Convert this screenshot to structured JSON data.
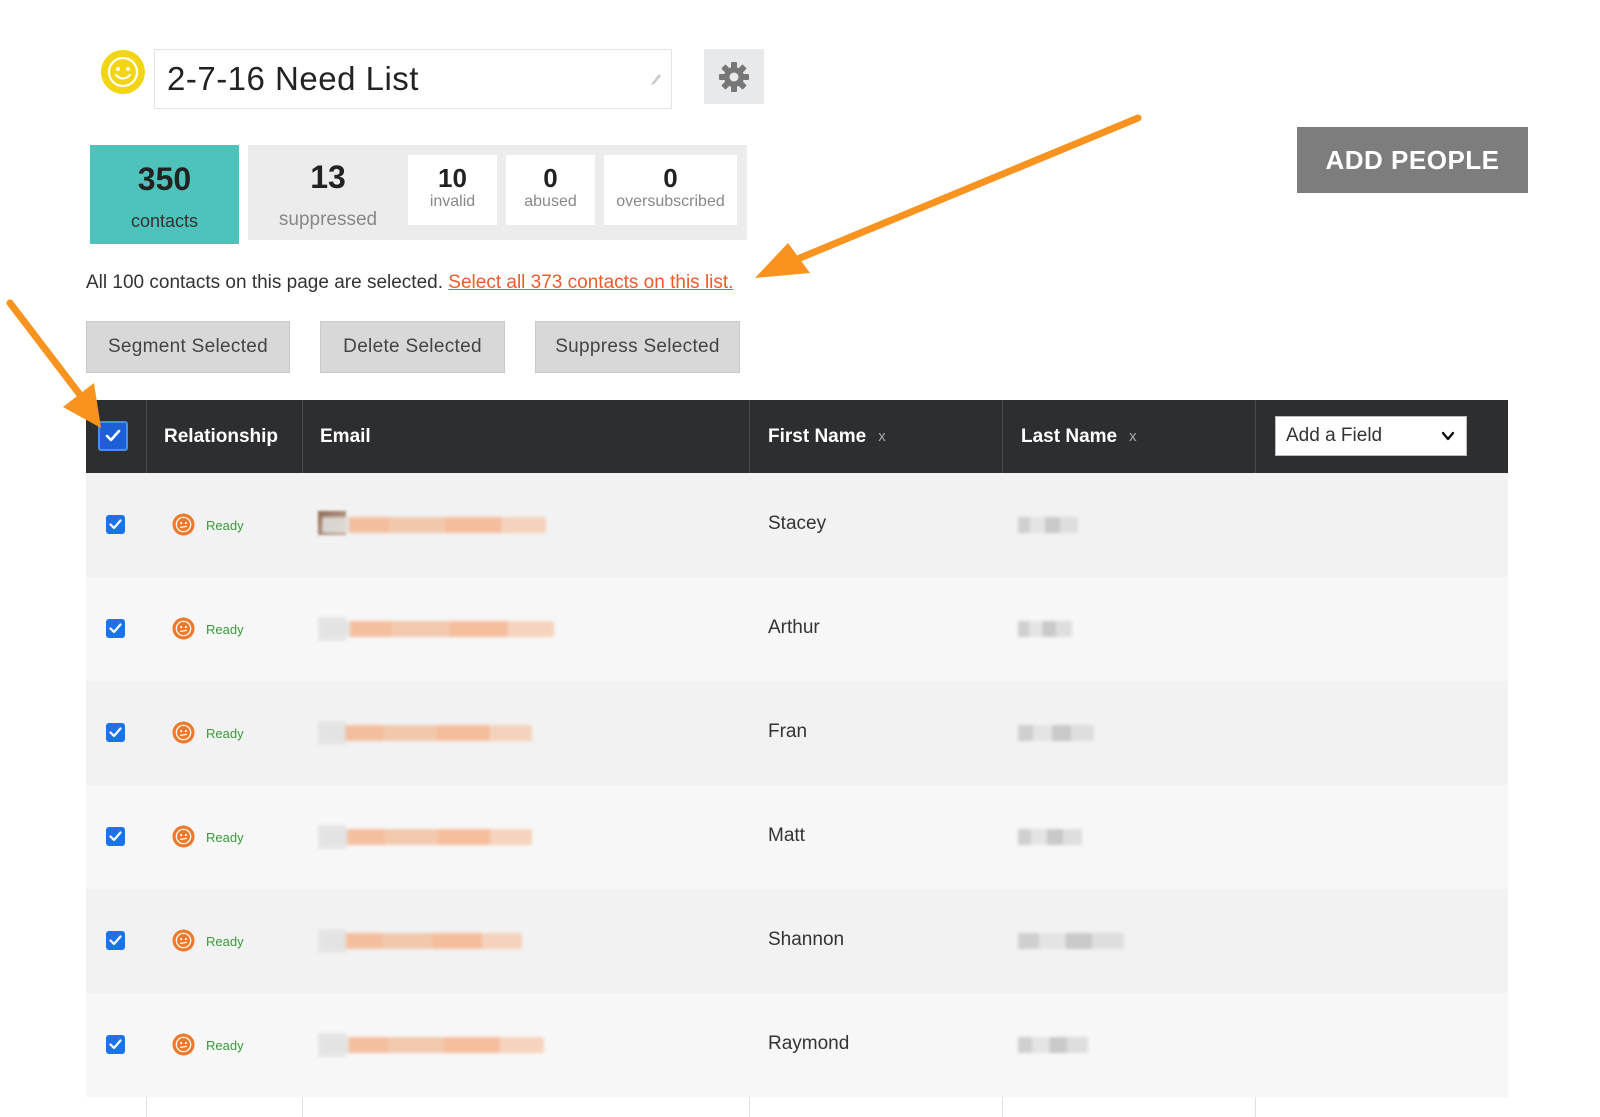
{
  "header": {
    "list_title": "2-7-16 Need List",
    "add_people_label": "ADD PEOPLE"
  },
  "stats": {
    "contacts": {
      "value": "350",
      "label": "contacts"
    },
    "suppressed": {
      "value": "13",
      "label": "suppressed"
    },
    "invalid": {
      "value": "10",
      "label": "invalid"
    },
    "abused": {
      "value": "0",
      "label": "abused"
    },
    "oversubscribed": {
      "value": "0",
      "label": "oversubscribed"
    }
  },
  "selection": {
    "message": "All 100 contacts on this page are selected.",
    "select_all_link": "Select all 373 contacts on this list."
  },
  "actions": {
    "segment": "Segment Selected",
    "delete": "Delete Selected",
    "suppress": "Suppress Selected"
  },
  "table": {
    "columns": {
      "relationship": "Relationship",
      "email": "Email",
      "first_name": "First Name",
      "last_name": "Last Name",
      "remove_symbol": "x",
      "add_field": "Add a Field"
    },
    "rows": [
      {
        "status": "Ready",
        "first_name": "Stacey",
        "checked": true
      },
      {
        "status": "Ready",
        "first_name": "Arthur",
        "checked": true
      },
      {
        "status": "Ready",
        "first_name": "Fran",
        "checked": true
      },
      {
        "status": "Ready",
        "first_name": "Matt",
        "checked": true
      },
      {
        "status": "Ready",
        "first_name": "Shannon",
        "checked": true
      },
      {
        "status": "Ready",
        "first_name": "Raymond",
        "checked": true
      }
    ]
  },
  "colors": {
    "accent_teal": "#4ec3bb",
    "link_orange": "#f05a28",
    "annotation_arrow": "#f7931e",
    "status_green": "#3a9a3a",
    "header_dark": "#2d2e30"
  },
  "icons": [
    "smiley-icon",
    "pencil-icon",
    "gear-icon",
    "checkbox-checked-icon",
    "relationship-face-icon",
    "chevron-down-icon",
    "annotation-arrow"
  ]
}
